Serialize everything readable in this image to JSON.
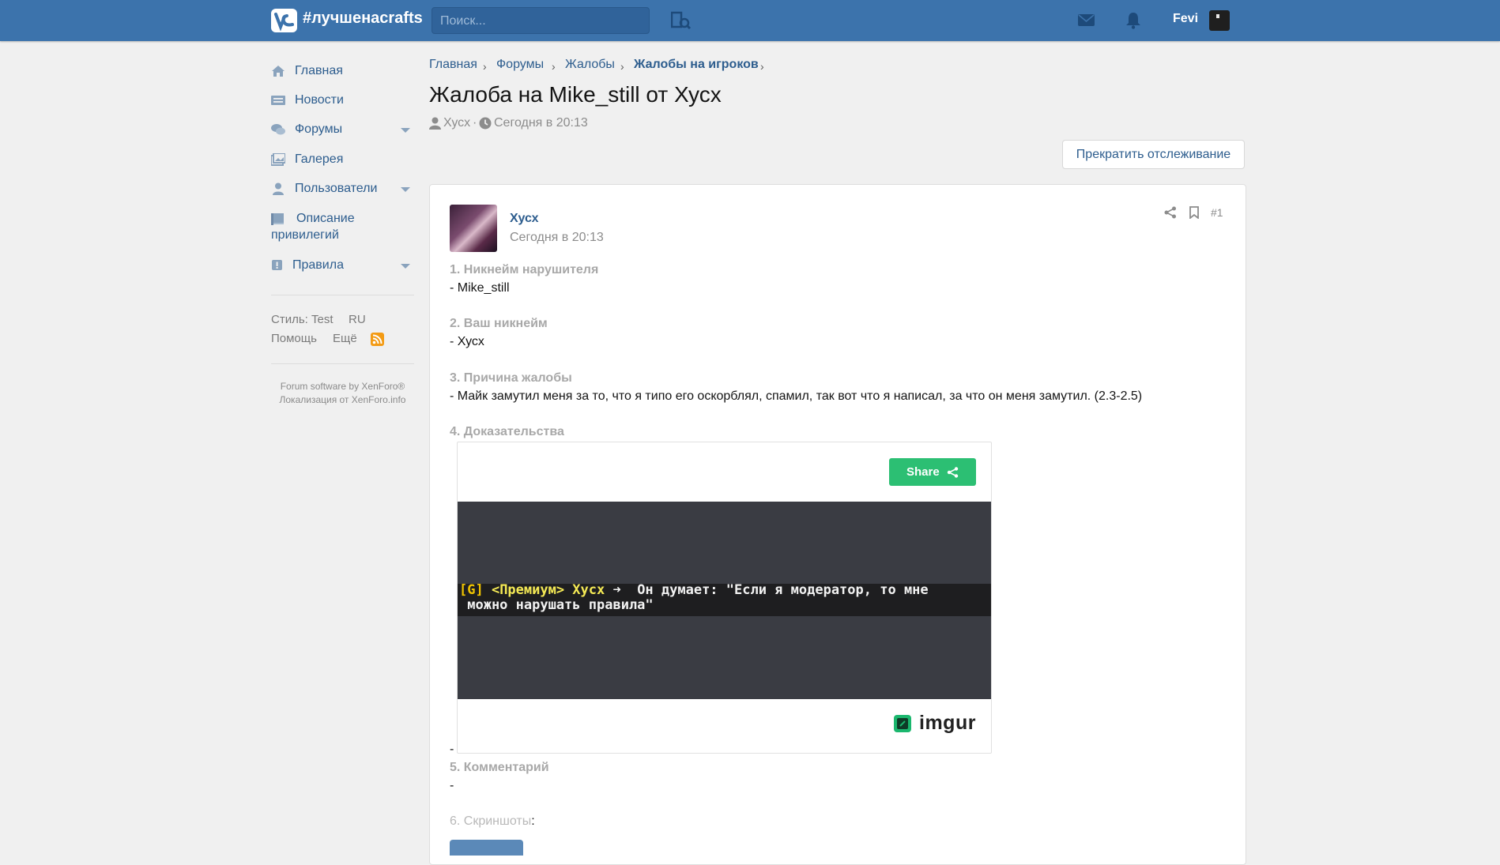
{
  "header": {
    "site_name": "#лучшенacrafts",
    "search_placeholder": "Поиск...",
    "username": "Fevi"
  },
  "sidebar": {
    "items": [
      {
        "label": "Главная",
        "icon": "home-icon"
      },
      {
        "label": "Новости",
        "icon": "news-icon"
      },
      {
        "label": "Форумы",
        "icon": "comments-icon"
      },
      {
        "label": "Галерея",
        "icon": "gallery-icon"
      },
      {
        "label": "Пользователи",
        "icon": "user-icon"
      },
      {
        "label_line1": "Описание",
        "label_line2": "привилегий",
        "icon": "book-icon"
      },
      {
        "label": "Правила",
        "icon": "exclamation-icon"
      }
    ],
    "style_label": "Стиль: Test",
    "lang_label": "RU",
    "help_label": "Помощь",
    "more_label": "Ещё",
    "footer_line1": "Forum software by XenForo®",
    "footer_line2": "Локализация от XenForo.info"
  },
  "breadcrumb": [
    "Главная",
    "Форумы",
    "Жалобы",
    "Жалобы на игроков"
  ],
  "thread": {
    "title": "Жалоба на Mike_still от Хусх",
    "author": "Хусх",
    "separator": "·",
    "date": "Сегодня в 20:13",
    "unwatch_label": "Прекратить отслеживание"
  },
  "post": {
    "author": "Хусх",
    "date": "Сегодня в 20:13",
    "number": "#1",
    "q1": "1. Никнейм нарушителя",
    "a1": "- Mike_still",
    "q2": "2. Ваш никнейм",
    "a2": "- Хусх",
    "q3": "3. Причина жалобы",
    "a3": "- Майк замутил меня за то, что я типо его оскорблял, спамил, так вот что я написал, за что он меня замутил. (2.3-2.5)",
    "q4": "4. Доказательства",
    "a4": "-",
    "q5": "5. Комментарий",
    "a5": "-",
    "q6": "6. Скриншоты",
    "q6_suffix": ":"
  },
  "embed": {
    "share_label": "Share",
    "chat_prefix": "[G]",
    "chat_rank": " <Премиум> Хусх",
    "chat_msg": " ➜  Он думает: \"Если я модератор, то мне",
    "chat_line2": " можно нарушать правила\"",
    "brand": "imgur"
  }
}
